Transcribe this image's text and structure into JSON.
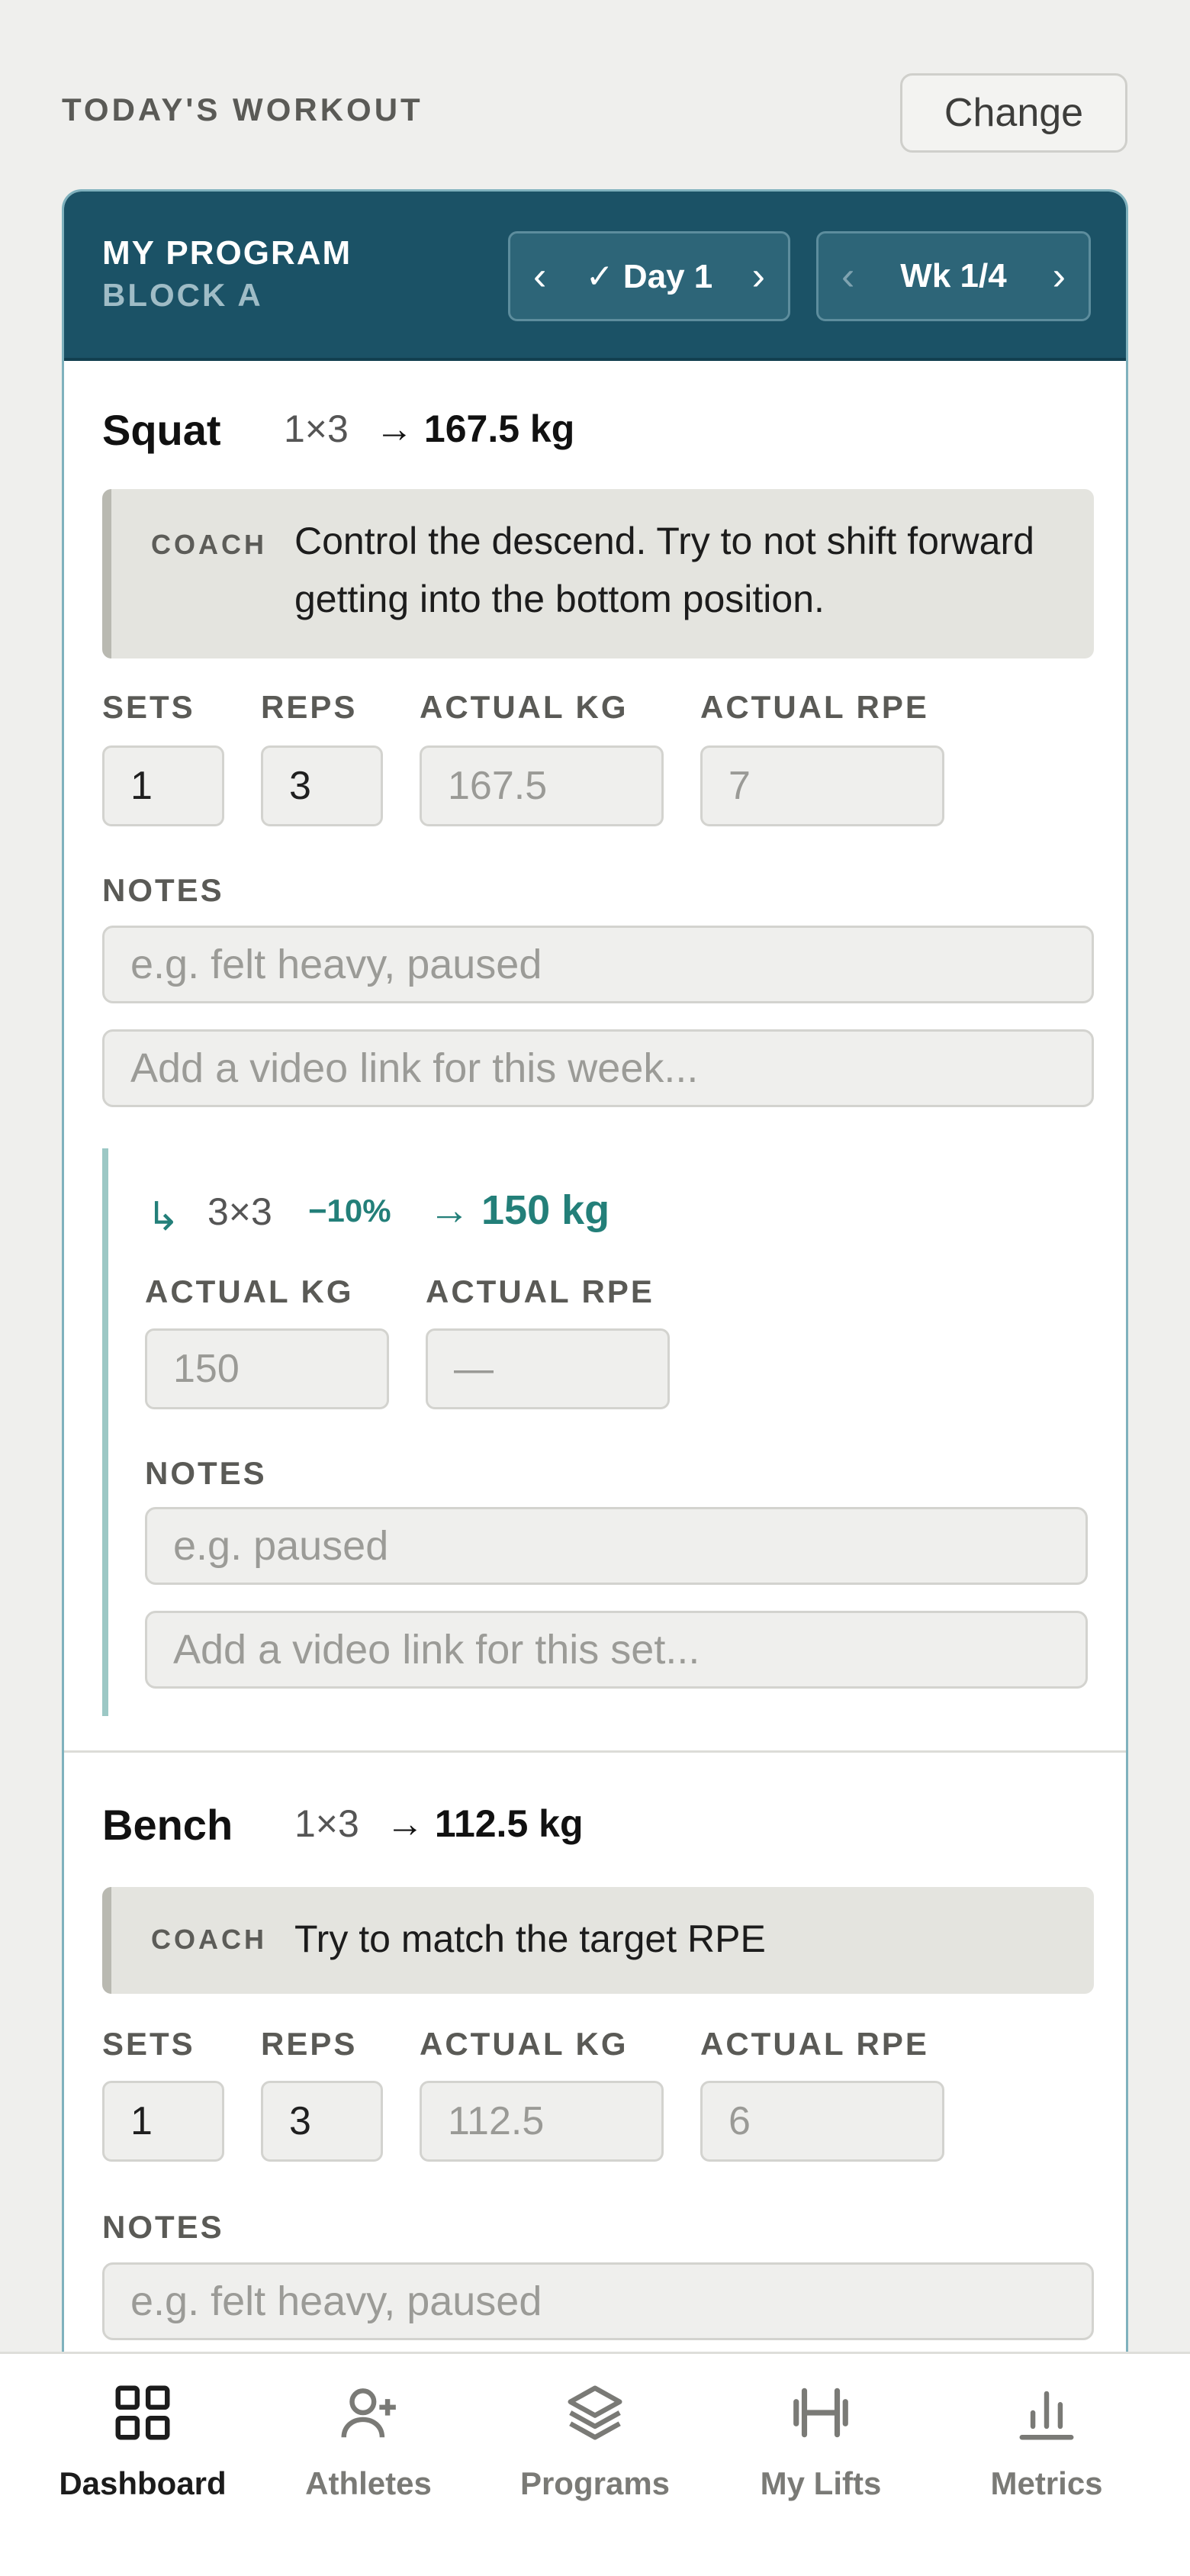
{
  "header": {
    "title": "TODAY'S WORKOUT",
    "change_label": "Change"
  },
  "program": {
    "name": "MY PROGRAM",
    "block": "BLOCK A",
    "day": {
      "prev": "‹",
      "label": "✓ Day 1",
      "next": "›"
    },
    "week": {
      "prev": "‹",
      "label": "Wk 1/4",
      "next": "›"
    }
  },
  "labels": {
    "coach": "COACH",
    "sets": "SETS",
    "reps": "REPS",
    "actual_kg": "ACTUAL KG",
    "actual_rpe": "ACTUAL RPE",
    "notes": "NOTES"
  },
  "exercises": [
    {
      "name": "Squat",
      "scheme": "1×3",
      "target": "→ 167.5 kg",
      "coach_note": "Control the descend. Try to not shift forward getting into the bottom position.",
      "sets": "1",
      "reps": "3",
      "actual_kg": "167.5",
      "actual_rpe": "7",
      "notes_placeholder": "e.g. felt heavy, paused",
      "video_placeholder": "Add a video link for this week...",
      "backoff": {
        "arrow": "↳",
        "scheme": "3×3",
        "percent": "−10%",
        "target": "→ 150 kg",
        "actual_kg": "150",
        "actual_rpe": "—",
        "notes_placeholder": "e.g. paused",
        "video_placeholder": "Add a video link for this set..."
      }
    },
    {
      "name": "Bench",
      "scheme": "1×3",
      "target": "→ 112.5 kg",
      "coach_note": "Try to match the target RPE",
      "sets": "1",
      "reps": "3",
      "actual_kg": "112.5",
      "actual_rpe": "6",
      "notes_placeholder": "e.g. felt heavy, paused"
    }
  ],
  "nav": [
    {
      "label": "Dashboard",
      "icon": "grid-icon",
      "active": true
    },
    {
      "label": "Athletes",
      "icon": "user-plus-icon",
      "active": false
    },
    {
      "label": "Programs",
      "icon": "layers-icon",
      "active": false
    },
    {
      "label": "My Lifts",
      "icon": "barbell-icon",
      "active": false
    },
    {
      "label": "Metrics",
      "icon": "bar-chart-icon",
      "active": false
    }
  ],
  "colors": {
    "header_bg": "#1b5266",
    "accent_teal": "#237f79",
    "page_bg": "#efefed"
  }
}
